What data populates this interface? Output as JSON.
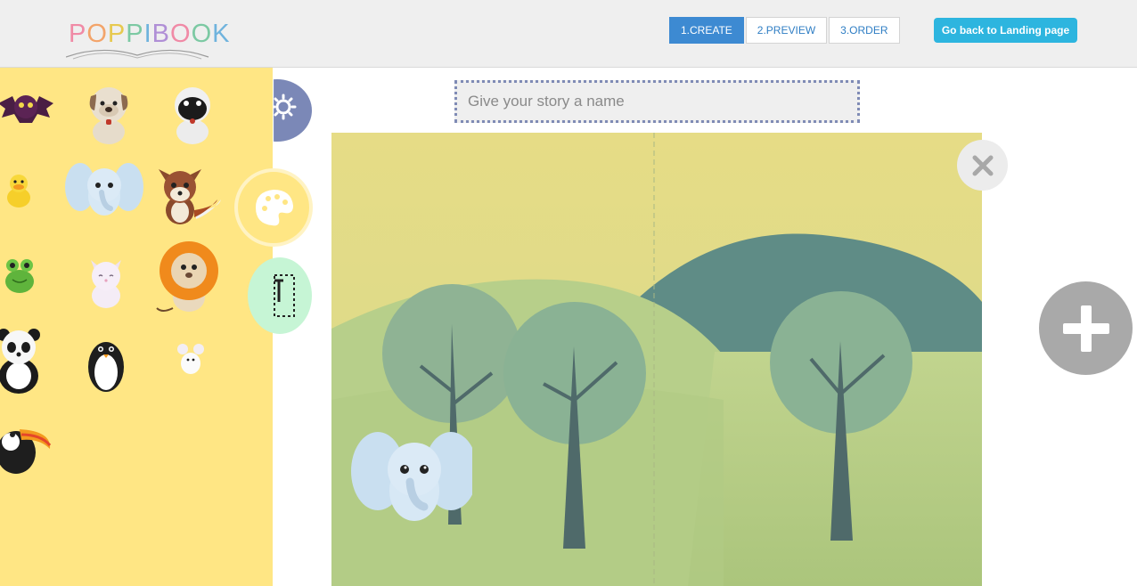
{
  "header": {
    "logo_text": "POPPIBOOK",
    "logo_colors": [
      "#f08aa6",
      "#f3a46a",
      "#e7c94f",
      "#7cc9a3",
      "#6fb3dd",
      "#b08fd6",
      "#f08aa6",
      "#7cc9a3",
      "#6fb3dd"
    ],
    "steps": [
      {
        "label": "1.CREATE",
        "active": true
      },
      {
        "label": "2.PREVIEW",
        "active": false
      },
      {
        "label": "3.ORDER",
        "active": false
      }
    ],
    "landing_button": "Go back to Landing page"
  },
  "sidebar": {
    "animals": [
      "bat",
      "dog",
      "pug",
      "duck",
      "elephant",
      "fox",
      "frog",
      "cat",
      "lion",
      "panda",
      "penguin",
      "mouse",
      "toucan"
    ],
    "tabs": [
      "settings-tab",
      "palette-tab",
      "text-tab"
    ]
  },
  "story": {
    "title_placeholder": "Give your story a name",
    "title_value": ""
  },
  "colors": {
    "sidebar": "#ffe684",
    "step_active": "#3d8ad2",
    "landing_button": "#2db5df",
    "canvas_sky": "#e8dd8a",
    "canvas_ground": "#b6cf8a"
  }
}
